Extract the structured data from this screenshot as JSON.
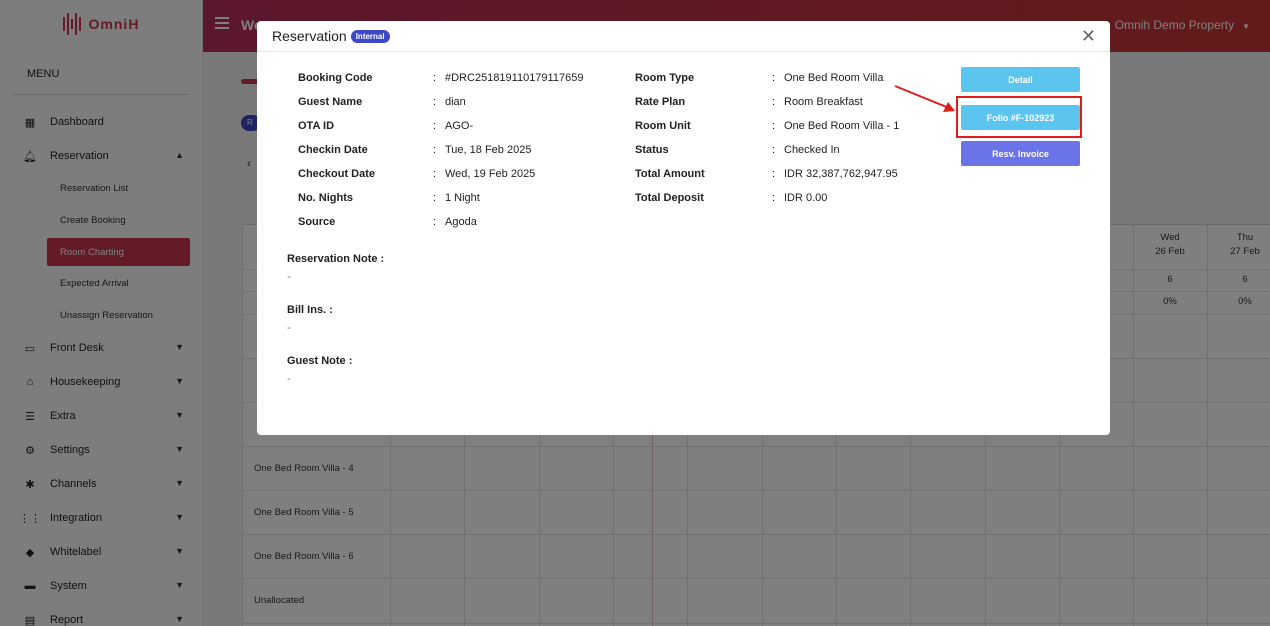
{
  "app": {
    "logo_text": "OmniH",
    "menu_title": "MENU",
    "topbar_title": "We",
    "property_name": "Omnih Demo Property"
  },
  "sidebar": {
    "items": [
      {
        "label": "Dashboard",
        "icon": "dashboard-icon"
      },
      {
        "label": "Reservation",
        "icon": "bell-icon",
        "expanded": true
      },
      {
        "label": "Front Desk",
        "icon": "window-icon"
      },
      {
        "label": "Housekeeping",
        "icon": "broom-icon"
      },
      {
        "label": "Extra",
        "icon": "list-icon"
      },
      {
        "label": "Settings",
        "icon": "gear-icon"
      },
      {
        "label": "Channels",
        "icon": "network-icon"
      },
      {
        "label": "Integration",
        "icon": "grid-icon"
      },
      {
        "label": "Whitelabel",
        "icon": "tag-icon"
      },
      {
        "label": "System",
        "icon": "laptop-icon"
      },
      {
        "label": "Report",
        "icon": "report-icon"
      }
    ],
    "reservation_sub": [
      {
        "label": "Reservation List"
      },
      {
        "label": "Create Booking"
      },
      {
        "label": "Room Charting",
        "active": true
      },
      {
        "label": "Expected Arrival"
      },
      {
        "label": "Unassign Reservation"
      }
    ]
  },
  "background": {
    "pill_text": "R",
    "rooms": [
      "One Bed Room Villa - 4",
      "One Bed Room Villa - 5",
      "One Bed Room Villa - 6",
      "Unallocated"
    ],
    "days": [
      {
        "dow": "Wed",
        "date": "26 Feb",
        "count": "6",
        "pct": "0%"
      },
      {
        "dow": "Thu",
        "date": "27 Feb",
        "count": "6",
        "pct": "0%"
      }
    ]
  },
  "modal": {
    "title": "Reservation",
    "badge": "Internal",
    "left_fields": [
      {
        "label": "Booking Code",
        "value": "#DRC251819110179117659"
      },
      {
        "label": "Guest Name",
        "value": "dian"
      },
      {
        "label": "OTA ID",
        "value": "AGO-"
      },
      {
        "label": "Checkin Date",
        "value": "Tue, 18 Feb 2025"
      },
      {
        "label": "Checkout Date",
        "value": "Wed, 19 Feb 2025"
      },
      {
        "label": "No. Nights",
        "value": "1 Night"
      },
      {
        "label": "Source",
        "value": "Agoda"
      }
    ],
    "right_fields": [
      {
        "label": "Room Type",
        "value": "One Bed Room Villa"
      },
      {
        "label": "Rate Plan",
        "value": "Room Breakfast"
      },
      {
        "label": "Room Unit",
        "value": "One Bed Room Villa - 1"
      },
      {
        "label": "Status",
        "value": "Checked In"
      },
      {
        "label": "Total Amount",
        "value": "IDR 32,387,762,947.95"
      },
      {
        "label": "Total Deposit",
        "value": "IDR 0.00"
      }
    ],
    "notes": [
      {
        "label": "Reservation Note :",
        "value": "-"
      },
      {
        "label": "Bill Ins. :",
        "value": "-"
      },
      {
        "label": "Guest Note :",
        "value": "-"
      }
    ],
    "buttons": {
      "detail": "Detail",
      "folio": "Folio #F-102923",
      "invoice": "Resv. Invoice"
    },
    "colon": ":"
  }
}
